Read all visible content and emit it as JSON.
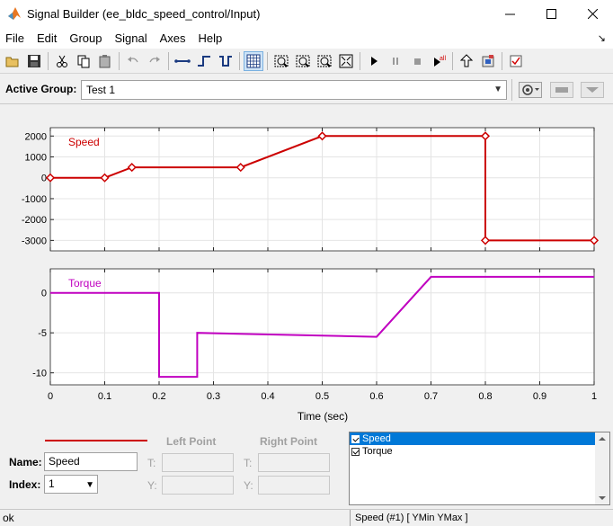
{
  "window": {
    "title": "Signal Builder (ee_bldc_speed_control/Input)"
  },
  "menu": [
    "File",
    "Edit",
    "Group",
    "Signal",
    "Axes",
    "Help"
  ],
  "menu_arrow": "↘",
  "toolbar": {
    "buttons": [
      "open-icon",
      "save-icon",
      "cut-icon",
      "copy-icon",
      "paste-icon",
      "undo-icon",
      "redo-icon",
      "segment-icon",
      "step-up-icon",
      "step-down-icon",
      "grid-icon",
      "zoom-x-icon",
      "zoom-y-icon",
      "zoom-xy-icon",
      "fit-icon",
      "play-icon",
      "pause-icon",
      "stop-icon",
      "play-all-icon",
      "up-arrow-icon",
      "import-icon",
      "check-icon"
    ]
  },
  "group": {
    "label": "Active Group:",
    "selected": "Test 1"
  },
  "plots": {
    "xlabel": "Time (sec)",
    "x_ticks": [
      "0",
      "0.1",
      "0.2",
      "0.3",
      "0.4",
      "0.5",
      "0.6",
      "0.7",
      "0.8",
      "0.9",
      "1"
    ],
    "speed": {
      "label": "Speed",
      "color": "#cc0000",
      "y_ticks": [
        "2000",
        "1000",
        "0",
        "-1000",
        "-2000",
        "-3000"
      ]
    },
    "torque": {
      "label": "Torque",
      "color": "#c000c0",
      "y_ticks": [
        "0",
        "-5",
        "-10"
      ]
    }
  },
  "chart_data": [
    {
      "type": "line",
      "name": "Speed",
      "x": [
        0,
        0.1,
        0.15,
        0.35,
        0.5,
        0.8,
        0.8,
        1.0
      ],
      "y": [
        0,
        0,
        500,
        500,
        2000,
        2000,
        -3000,
        -3000
      ],
      "xlim": [
        0,
        1
      ],
      "ylim": [
        -3500,
        2400
      ],
      "grid": true
    },
    {
      "type": "line",
      "name": "Torque",
      "x": [
        0,
        0.2,
        0.2,
        0.27,
        0.27,
        0.6,
        0.7,
        1.0
      ],
      "y": [
        0,
        0,
        -10.5,
        -10.5,
        -5,
        -5.5,
        2,
        2
      ],
      "xlim": [
        0,
        1
      ],
      "ylim": [
        -11.5,
        3
      ],
      "grid": true
    }
  ],
  "editor": {
    "name_label": "Name:",
    "name_value": "Speed",
    "index_label": "Index:",
    "index_value": "1",
    "left_point": "Left Point",
    "right_point": "Right Point",
    "t_label": "T:",
    "y_label": "Y:"
  },
  "signal_list": [
    {
      "label": "Speed",
      "checked": true,
      "selected": true
    },
    {
      "label": "Torque",
      "checked": true,
      "selected": false
    }
  ],
  "status": {
    "left": "ok",
    "right": "Speed (#1)  [ YMin YMax ]"
  }
}
